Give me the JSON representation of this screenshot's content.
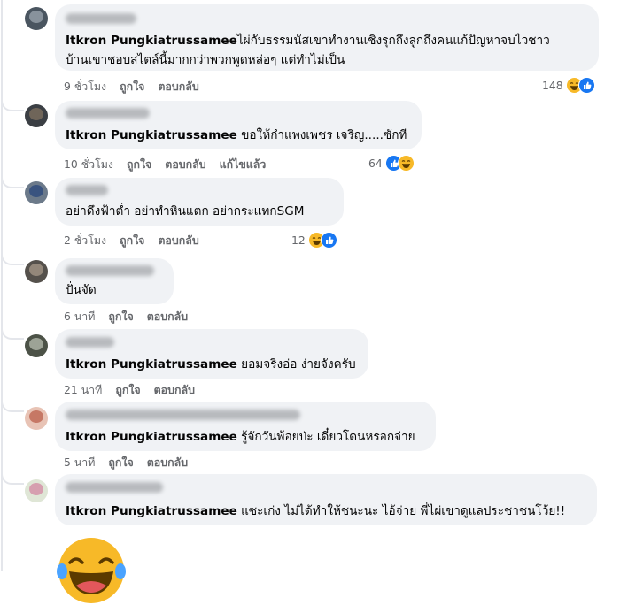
{
  "comments": [
    {
      "tag": "Itkron Pungkiatrussamee",
      "text_line1": "ไผ่กับธรรมนัสเขาทำงานเชิงรุกถึงลูกถึงคนแก้ปัญหาจบไวชาว",
      "text_line2": "บ้านเขาชอบสไตล์นี้มากกว่าพวกพูดหล่อๆ แต่ทำไม่เป็น",
      "time": "9 ชั่วโมง",
      "like": "ถูกใจ",
      "reply": "ตอบกลับ",
      "reactions": "148"
    },
    {
      "tag": "Itkron Pungkiatrussamee",
      "text": " ขอให้กำแพงเพชร เจริญ.....ซักที",
      "time": "10 ชั่วโมง",
      "like": "ถูกใจ",
      "reply": "ตอบกลับ",
      "edited": "แก้ไขแล้ว",
      "reactions": "64"
    },
    {
      "text": "อย่าดึงฟ้าต่ำ อย่าทำหินแตก อย่ากระแทกSGM",
      "time": "2 ชั่วโมง",
      "like": "ถูกใจ",
      "reply": "ตอบกลับ",
      "reactions": "12"
    },
    {
      "text": "ปั่นจัด",
      "time": "6 นาที",
      "like": "ถูกใจ",
      "reply": "ตอบกลับ"
    },
    {
      "tag": "Itkron Pungkiatrussamee",
      "text": " ยอมจริงอ่อ ง่ายจังครับ",
      "time": "21 นาที",
      "like": "ถูกใจ",
      "reply": "ตอบกลับ"
    },
    {
      "tag": "Itkron Pungkiatrussamee",
      "text": " รู้จักวันพ้อยป่ะ เดี๋ยวโดนหรอกจ่าย",
      "time": "5 นาที",
      "like": "ถูกใจ",
      "reply": "ตอบกลับ"
    },
    {
      "tag": "Itkron Pungkiatrussamee",
      "text": " แซะเก่ง ไม่ได้ทำให้ชนะนะ ไอ้จ่าย พี่ไผ่เขาดูแลประชาชนโว้ย!!"
    }
  ],
  "colors": {
    "bubble": "#f0f2f5",
    "meta_text": "#65676b",
    "like_blue": "#1877f2",
    "haha_yellow": "#f7b928",
    "thread_line": "#e4e6eb"
  },
  "icons": [
    "like-reaction-icon",
    "haha-reaction-icon",
    "haha-sticker"
  ]
}
